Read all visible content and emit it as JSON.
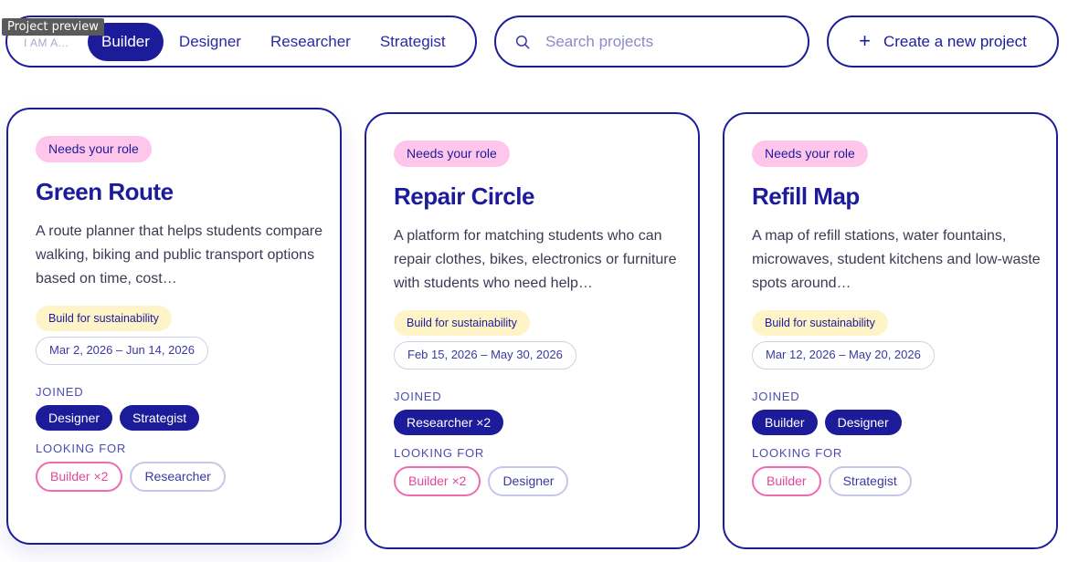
{
  "tooltip": "Project preview",
  "role_filter": {
    "prefix": "I AM A...",
    "roles": [
      "Builder",
      "Designer",
      "Researcher",
      "Strategist"
    ],
    "selected": "Builder"
  },
  "search": {
    "placeholder": "Search projects",
    "value": ""
  },
  "create_button": {
    "icon": "+",
    "label": "Create a new project"
  },
  "labels": {
    "joined": "JOINED",
    "looking_for": "LOOKING FOR"
  },
  "colors": {
    "primary": "#1c1c9a",
    "role_badge": "#ffc6ec",
    "theme_badge": "#fff4c8",
    "pink": "#f06ab0"
  },
  "projects": [
    {
      "status": "Needs your role",
      "title": "Green Route",
      "description": "A route planner that helps students compare walking, biking and public transport options based on time, cost…",
      "theme": "Build for sustainability",
      "dates": "Mar 2, 2026 – Jun 14, 2026",
      "joined": [
        "Designer",
        "Strategist"
      ],
      "looking_for": [
        "Builder ×2",
        "Researcher"
      ]
    },
    {
      "status": "Needs your role",
      "title": "Repair Circle",
      "description": "A platform for matching students who can repair clothes, bikes, electronics or furniture with students who need help…",
      "theme": "Build for sustainability",
      "dates": "Feb 15, 2026 – May 30, 2026",
      "joined": [
        "Researcher ×2"
      ],
      "looking_for": [
        "Builder ×2",
        "Designer"
      ]
    },
    {
      "status": "Needs your role",
      "title": "Refill Map",
      "description": "A map of refill stations, water fountains, microwaves, student kitchens and low-waste spots around…",
      "theme": "Build for sustainability",
      "dates": "Mar 12, 2026 – May 20, 2026",
      "joined": [
        "Builder",
        "Designer"
      ],
      "looking_for": [
        "Builder",
        "Strategist"
      ]
    }
  ]
}
